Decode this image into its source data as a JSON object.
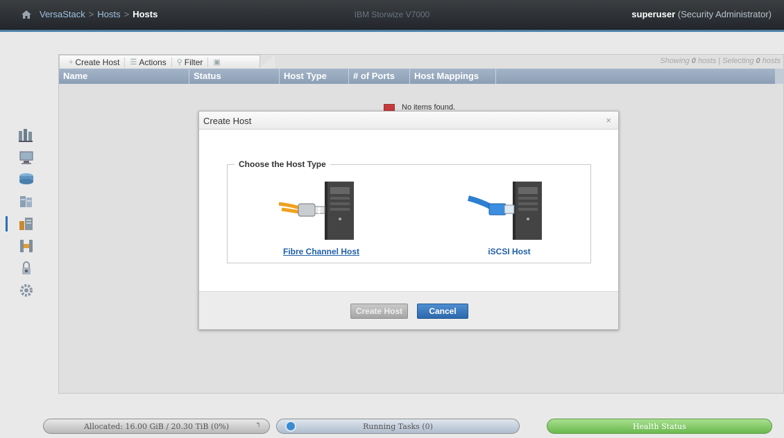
{
  "topbar": {
    "breadcrumbs": [
      "VersaStack",
      "Hosts",
      "Hosts"
    ],
    "separator": ">",
    "product": "IBM Storwize V7000",
    "user": "superuser",
    "role": "(Security Administrator)"
  },
  "sidebar": {
    "icons": [
      "monitoring-icon",
      "pools-icon",
      "volumes-icon",
      "hosts-icon",
      "copy-services-icon",
      "access-icon",
      "settings-icon"
    ]
  },
  "toolbar": {
    "create_host": "Create Host",
    "actions": "Actions",
    "filter": "Filter",
    "showing_prefix": "Showing",
    "hosts_count": "0",
    "hosts_label": "hosts | Selecting",
    "selected_count": "0",
    "selected_label": "hosts"
  },
  "grid": {
    "columns": [
      "Name",
      "Status",
      "Host Type",
      "# of Ports",
      "Host Mappings"
    ],
    "empty_message": "No items found."
  },
  "dialog": {
    "title": "Create Host",
    "close": "×",
    "legend": "Choose the Host Type",
    "options": [
      "Fibre Channel Host",
      "iSCSI Host"
    ],
    "create_button": "Create Host",
    "cancel_button": "Cancel"
  },
  "status_bar": {
    "allocated": "Allocated: 16.00 GiB / 20.30 TiB (0%)",
    "running_tasks": "Running Tasks (0)",
    "health": "Health Status"
  },
  "colors": {
    "accent": "#2d68ac",
    "header_blue": "#8c9fb5",
    "health_green": "#69b84e",
    "link_blue": "#1f5fa8"
  }
}
